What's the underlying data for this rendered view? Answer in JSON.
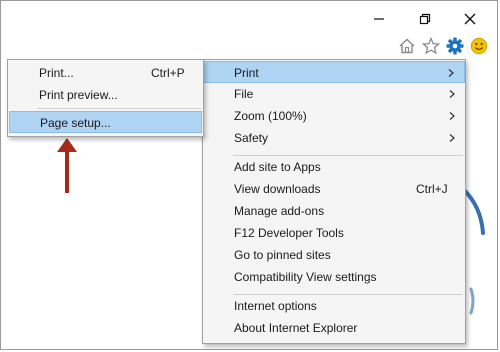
{
  "window": {
    "caption_buttons": [
      {
        "name": "minimize-button",
        "icon": "minimize-icon"
      },
      {
        "name": "restore-button",
        "icon": "restore-icon"
      },
      {
        "name": "close-button",
        "icon": "close-icon"
      }
    ]
  },
  "toolbar": {
    "icons": [
      "home-icon",
      "favorites-star-icon",
      "tools-gear-icon",
      "smiley-feedback-icon"
    ],
    "accent_color": "#1e73be",
    "smiley_color": "#f2c200"
  },
  "tools_menu": {
    "items": [
      {
        "label": "Print",
        "submenu": true,
        "highlighted": true
      },
      {
        "label": "File",
        "submenu": true
      },
      {
        "label": "Zoom (100%)",
        "submenu": true
      },
      {
        "label": "Safety",
        "submenu": true
      },
      {
        "label": "Add site to Apps"
      },
      {
        "label": "View downloads",
        "shortcut": "Ctrl+J"
      },
      {
        "label": "Manage add-ons"
      },
      {
        "label": "F12 Developer Tools"
      },
      {
        "label": "Go to pinned sites"
      },
      {
        "label": "Compatibility View settings"
      },
      {
        "label": "Internet options"
      },
      {
        "label": "About Internet Explorer"
      }
    ]
  },
  "print_submenu": {
    "items": [
      {
        "label": "Print...",
        "shortcut": "Ctrl+P"
      },
      {
        "label": "Print preview..."
      },
      {
        "label": "Page setup...",
        "highlighted": true
      }
    ]
  },
  "annotation": {
    "arrow_color": "#a52a1a"
  },
  "colors": {
    "menu_background": "#f5f5f5",
    "highlight": "#aed3f3",
    "highlight_border": "#8cbde8"
  }
}
